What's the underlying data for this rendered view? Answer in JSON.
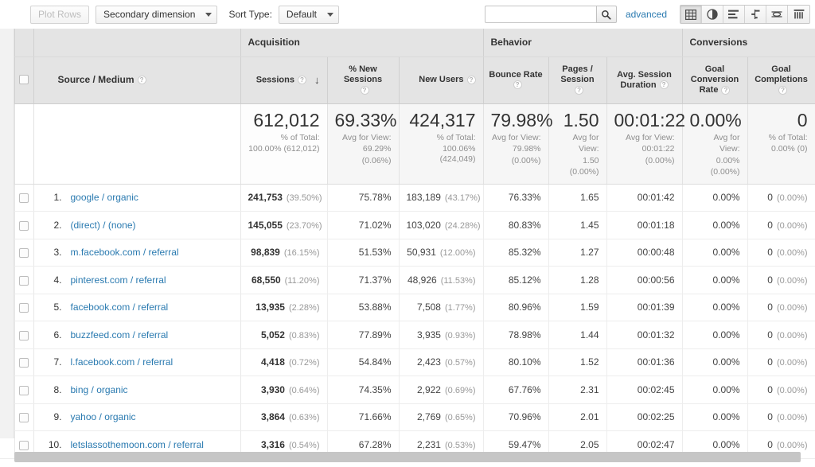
{
  "toolbar": {
    "plot_rows_label": "Plot Rows",
    "secondary_dimension_label": "Secondary dimension",
    "sort_type_label": "Sort Type:",
    "sort_type_value": "Default",
    "search_value": "",
    "search_placeholder": "",
    "advanced_label": "advanced",
    "view_buttons": [
      {
        "name": "table-view-icon",
        "active": true
      },
      {
        "name": "percentage-pie-view-icon",
        "active": false
      },
      {
        "name": "performance-bar-view-icon",
        "active": false
      },
      {
        "name": "comparison-view-icon",
        "active": false
      },
      {
        "name": "pivot-view-icon",
        "active": false
      },
      {
        "name": "terms-cloud-view-icon",
        "active": false
      }
    ]
  },
  "table": {
    "groups": [
      {
        "label": "Acquisition"
      },
      {
        "label": "Behavior"
      },
      {
        "label": "Conversions"
      }
    ],
    "dimension_header": "Source / Medium",
    "help_glyph": "?",
    "sort_arrow": "↓",
    "columns": [
      "Sessions",
      "% New Sessions",
      "New Users",
      "Bounce Rate",
      "Pages / Session",
      "Avg. Session Duration",
      "Goal Conversion Rate",
      "Goal Completions"
    ],
    "column_lines": {
      "sessions": [
        "Sessions"
      ],
      "new_sessions_pct": [
        "% New",
        "Sessions"
      ],
      "new_users": [
        "New Users"
      ],
      "bounce_rate": [
        "Bounce Rate"
      ],
      "pages_session": [
        "Pages /",
        "Session"
      ],
      "avg_duration": [
        "Avg. Session",
        "Duration"
      ],
      "goal_rate": [
        "Goal",
        "Conversion",
        "Rate"
      ],
      "goal_completions": [
        "Goal",
        "Completions"
      ]
    },
    "summary": {
      "sessions": {
        "value": "612,012",
        "note1": "% of Total:",
        "note2": "100.00% (612,012)"
      },
      "new_sessions_pct": {
        "value": "69.33%",
        "note1": "Avg for View:",
        "note2": "69.29%",
        "note3": "(0.06%)"
      },
      "new_users": {
        "value": "424,317",
        "note1": "% of Total:",
        "note2": "100.06% (424,049)"
      },
      "bounce_rate": {
        "value": "79.98%",
        "note1": "Avg for View:",
        "note2": "79.98%",
        "note3": "(0.00%)"
      },
      "pages_session": {
        "value": "1.50",
        "note1": "Avg for",
        "note2": "View:",
        "note3": "1.50",
        "note4": "(0.00%)"
      },
      "avg_duration": {
        "value": "00:01:22",
        "note1": "Avg for View:",
        "note2": "00:01:22",
        "note3": "(0.00%)"
      },
      "goal_rate": {
        "value": "0.00%",
        "note1": "Avg for",
        "note2": "View:",
        "note3": "0.00%",
        "note4": "(0.00%)"
      },
      "goal_completions": {
        "value": "0",
        "note1": "% of Total:",
        "note2": "0.00% (0)"
      }
    },
    "rows": [
      {
        "num": "1.",
        "source": "google / organic",
        "sessions": "241,753",
        "sessions_pct": "(39.50%)",
        "new_sessions_pct": "75.78%",
        "new_users": "183,189",
        "new_users_pct": "(43.17%)",
        "bounce_rate": "76.33%",
        "pages_session": "1.65",
        "avg_duration": "00:01:42",
        "goal_rate": "0.00%",
        "goal_completions": "0",
        "goal_completions_pct": "(0.00%)"
      },
      {
        "num": "2.",
        "source": "(direct) / (none)",
        "sessions": "145,055",
        "sessions_pct": "(23.70%)",
        "new_sessions_pct": "71.02%",
        "new_users": "103,020",
        "new_users_pct": "(24.28%)",
        "bounce_rate": "80.83%",
        "pages_session": "1.45",
        "avg_duration": "00:01:18",
        "goal_rate": "0.00%",
        "goal_completions": "0",
        "goal_completions_pct": "(0.00%)"
      },
      {
        "num": "3.",
        "source": "m.facebook.com / referral",
        "sessions": "98,839",
        "sessions_pct": "(16.15%)",
        "new_sessions_pct": "51.53%",
        "new_users": "50,931",
        "new_users_pct": "(12.00%)",
        "bounce_rate": "85.32%",
        "pages_session": "1.27",
        "avg_duration": "00:00:48",
        "goal_rate": "0.00%",
        "goal_completions": "0",
        "goal_completions_pct": "(0.00%)"
      },
      {
        "num": "4.",
        "source": "pinterest.com / referral",
        "sessions": "68,550",
        "sessions_pct": "(11.20%)",
        "new_sessions_pct": "71.37%",
        "new_users": "48,926",
        "new_users_pct": "(11.53%)",
        "bounce_rate": "85.12%",
        "pages_session": "1.28",
        "avg_duration": "00:00:56",
        "goal_rate": "0.00%",
        "goal_completions": "0",
        "goal_completions_pct": "(0.00%)"
      },
      {
        "num": "5.",
        "source": "facebook.com / referral",
        "sessions": "13,935",
        "sessions_pct": "(2.28%)",
        "new_sessions_pct": "53.88%",
        "new_users": "7,508",
        "new_users_pct": "(1.77%)",
        "bounce_rate": "80.96%",
        "pages_session": "1.59",
        "avg_duration": "00:01:39",
        "goal_rate": "0.00%",
        "goal_completions": "0",
        "goal_completions_pct": "(0.00%)"
      },
      {
        "num": "6.",
        "source": "buzzfeed.com / referral",
        "sessions": "5,052",
        "sessions_pct": "(0.83%)",
        "new_sessions_pct": "77.89%",
        "new_users": "3,935",
        "new_users_pct": "(0.93%)",
        "bounce_rate": "78.98%",
        "pages_session": "1.44",
        "avg_duration": "00:01:32",
        "goal_rate": "0.00%",
        "goal_completions": "0",
        "goal_completions_pct": "(0.00%)"
      },
      {
        "num": "7.",
        "source": "l.facebook.com / referral",
        "sessions": "4,418",
        "sessions_pct": "(0.72%)",
        "new_sessions_pct": "54.84%",
        "new_users": "2,423",
        "new_users_pct": "(0.57%)",
        "bounce_rate": "80.10%",
        "pages_session": "1.52",
        "avg_duration": "00:01:36",
        "goal_rate": "0.00%",
        "goal_completions": "0",
        "goal_completions_pct": "(0.00%)"
      },
      {
        "num": "8.",
        "source": "bing / organic",
        "sessions": "3,930",
        "sessions_pct": "(0.64%)",
        "new_sessions_pct": "74.35%",
        "new_users": "2,922",
        "new_users_pct": "(0.69%)",
        "bounce_rate": "67.76%",
        "pages_session": "2.31",
        "avg_duration": "00:02:45",
        "goal_rate": "0.00%",
        "goal_completions": "0",
        "goal_completions_pct": "(0.00%)"
      },
      {
        "num": "9.",
        "source": "yahoo / organic",
        "sessions": "3,864",
        "sessions_pct": "(0.63%)",
        "new_sessions_pct": "71.66%",
        "new_users": "2,769",
        "new_users_pct": "(0.65%)",
        "bounce_rate": "70.96%",
        "pages_session": "2.01",
        "avg_duration": "00:02:25",
        "goal_rate": "0.00%",
        "goal_completions": "0",
        "goal_completions_pct": "(0.00%)"
      },
      {
        "num": "10.",
        "source": "letslassothemoon.com / referral",
        "sessions": "3,316",
        "sessions_pct": "(0.54%)",
        "new_sessions_pct": "67.28%",
        "new_users": "2,231",
        "new_users_pct": "(0.53%)",
        "bounce_rate": "59.47%",
        "pages_session": "2.05",
        "avg_duration": "00:02:47",
        "goal_rate": "0.00%",
        "goal_completions": "0",
        "goal_completions_pct": "(0.00%)"
      }
    ]
  },
  "colors": {
    "link": "#2a7ab0",
    "header_bg": "#e4e4e4",
    "summary_bg": "#f6f6f6"
  }
}
